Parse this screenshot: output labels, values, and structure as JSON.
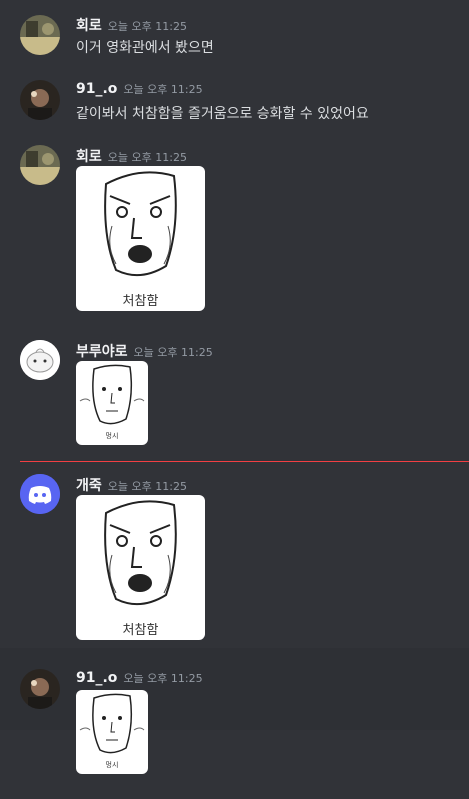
{
  "messages": [
    {
      "author": "회로",
      "time": "오늘 오후 11:25",
      "text": "이거 영화관에서 봤으면"
    },
    {
      "author": "91_.o",
      "time": "오늘 오후 11:25",
      "text": "같이봐서 처참함을 즐거움으로 승화할 수 있었어요"
    },
    {
      "author": "회로",
      "time": "오늘 오후 11:25",
      "sticker_caption": "처참함"
    },
    {
      "author": "부루야로",
      "time": "오늘 오후 11:25",
      "sticker_caption": "멍시"
    },
    {
      "author": "개죽",
      "time": "오늘 오후 11:25",
      "sticker_caption": "처참함"
    },
    {
      "author": "91_.o",
      "time": "오늘 오후 11:25",
      "sticker_caption": "멍시"
    }
  ],
  "colors": {
    "background": "#313338",
    "new_divider": "#f23f43",
    "discord_blurple": "#5865f2"
  }
}
